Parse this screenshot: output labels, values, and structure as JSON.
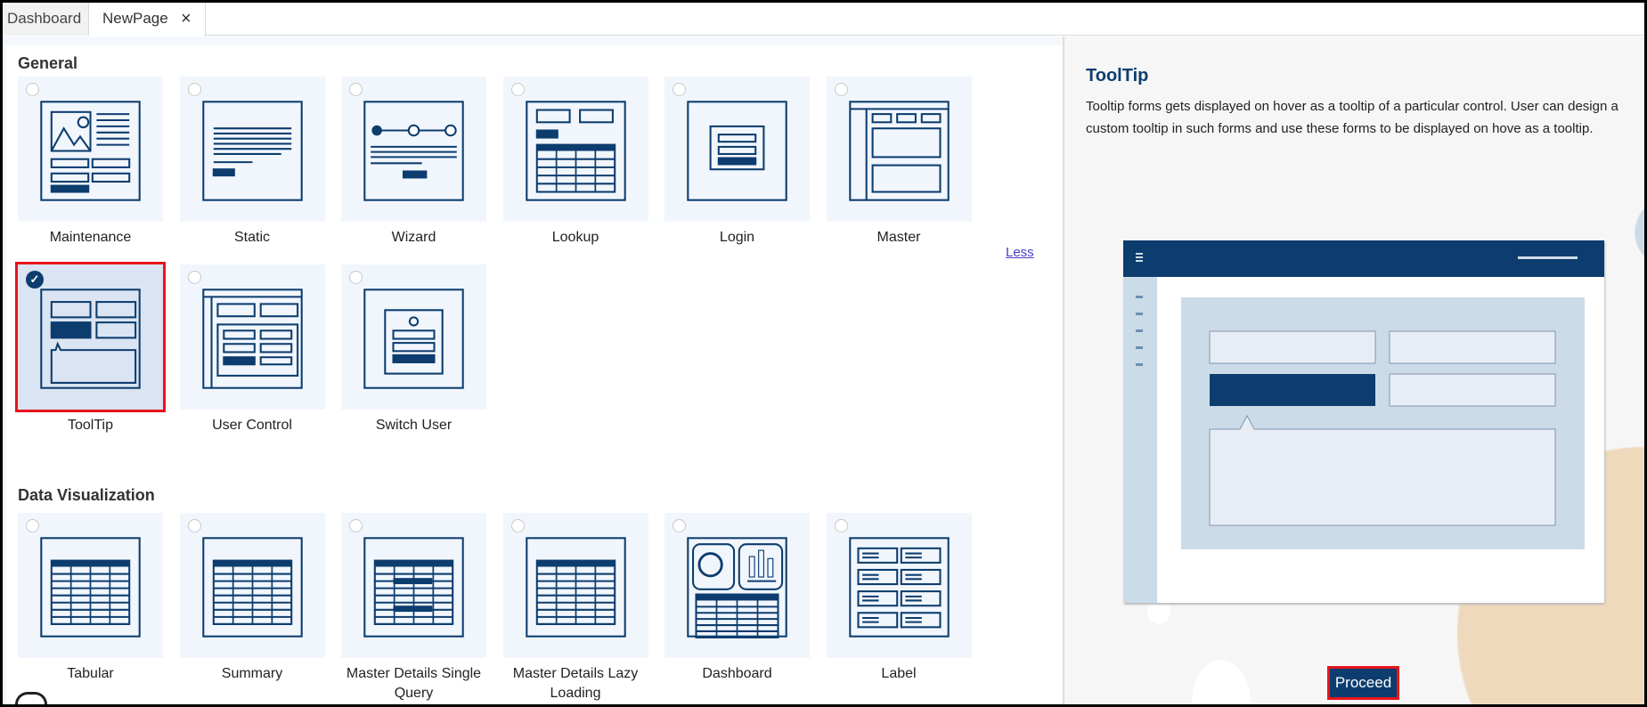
{
  "tabs": [
    {
      "label": "Dashboard"
    },
    {
      "label": "NewPage",
      "close": "×"
    }
  ],
  "sections": [
    {
      "title": "General",
      "items": [
        {
          "label": "Maintenance",
          "icon": "maintenance-icon",
          "selected": false
        },
        {
          "label": "Static",
          "icon": "static-icon",
          "selected": false
        },
        {
          "label": "Wizard",
          "icon": "wizard-icon",
          "selected": false
        },
        {
          "label": "Lookup",
          "icon": "lookup-icon",
          "selected": false
        },
        {
          "label": "Login",
          "icon": "login-icon",
          "selected": false
        },
        {
          "label": "Master",
          "icon": "master-icon",
          "selected": false
        },
        {
          "label": "ToolTip",
          "icon": "tooltip-icon",
          "selected": true
        },
        {
          "label": "User Control",
          "icon": "user-control-icon",
          "selected": false
        },
        {
          "label": "Switch User",
          "icon": "switch-user-icon",
          "selected": false
        }
      ],
      "less_label": "Less"
    },
    {
      "title": "Data Visualization",
      "items": [
        {
          "label": "Tabular",
          "icon": "tabular-icon",
          "selected": false
        },
        {
          "label": "Summary",
          "icon": "summary-icon",
          "selected": false
        },
        {
          "label": "Master Details Single Query",
          "icon": "master-details-single-icon",
          "selected": false
        },
        {
          "label": "Master Details Lazy Loading",
          "icon": "master-details-lazy-icon",
          "selected": false
        },
        {
          "label": "Dashboard",
          "icon": "dashboard-icon",
          "selected": false
        },
        {
          "label": "Label",
          "icon": "label-icon",
          "selected": false
        }
      ]
    }
  ],
  "detail": {
    "title": "ToolTip",
    "description": "Tooltip forms gets displayed on hover as a tooltip of a particular control. User can design a custom tooltip in such forms and use these forms to be displayed on hove as a tooltip.",
    "proceed_label": "Proceed"
  },
  "colors": {
    "accent": "#0d3d6e",
    "selection": "#e8141c",
    "peach": "#efd9bd"
  }
}
